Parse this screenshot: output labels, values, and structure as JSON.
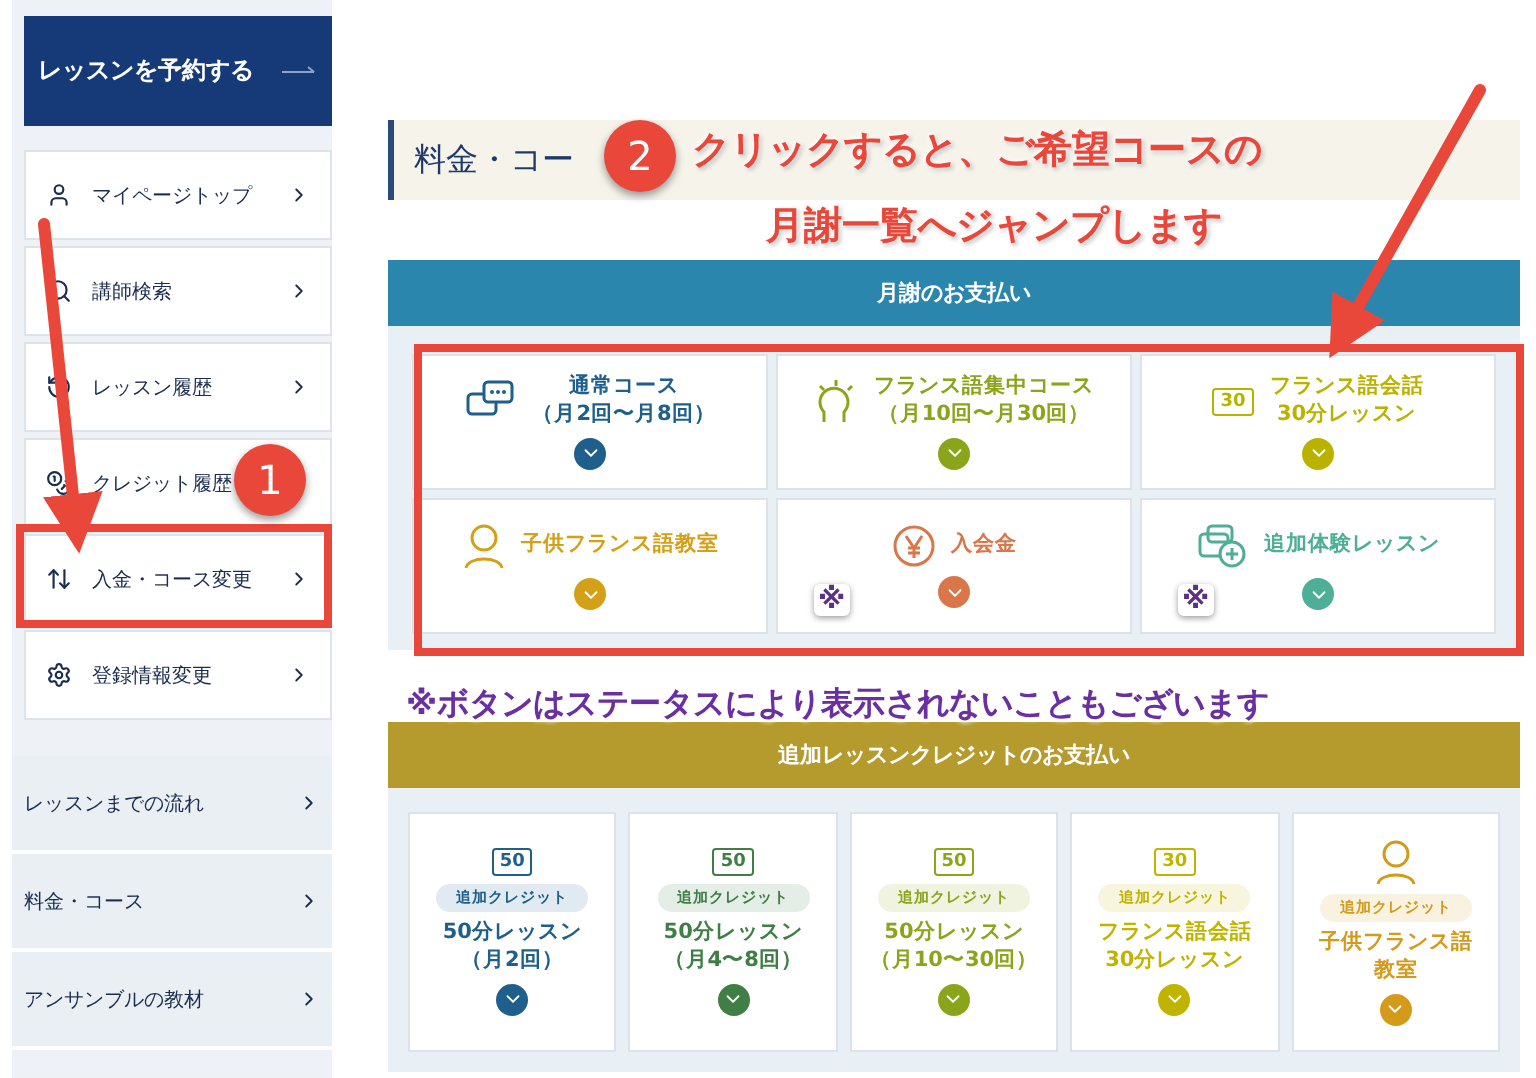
{
  "sidebar": {
    "reserve_button": "レッスンを予約する",
    "menu": [
      {
        "kind": "user",
        "label": "マイページトップ"
      },
      {
        "kind": "search",
        "label": "講師検索"
      },
      {
        "kind": "history",
        "label": "レッスン履歴"
      },
      {
        "kind": "coins",
        "label": "クレジット履歴"
      },
      {
        "kind": "updown",
        "label": "入金・コース変更"
      },
      {
        "kind": "gear",
        "label": "登録情報変更"
      }
    ],
    "links": [
      "レッスンまでの流れ",
      "料金・コース",
      "アンサンブルの教材"
    ]
  },
  "page_title": "料金・コー",
  "monthly": {
    "header": "月謝のお支払い",
    "cards": [
      {
        "kind": "chat",
        "lines": [
          "通常コース",
          "（月2回〜月8回）"
        ],
        "color": "#1f5f8b"
      },
      {
        "kind": "head",
        "lines": [
          "フランス語集中コース",
          "（月10回〜月30回）"
        ],
        "color": "#8aa51a"
      },
      {
        "kind": "number",
        "badge": "30",
        "lines": [
          "フランス語会話",
          "30分レッスン"
        ],
        "color": "#b9b300"
      },
      {
        "kind": "person",
        "lines": [
          "子供フランス語教室"
        ],
        "color": "#d4a017"
      },
      {
        "kind": "yen",
        "lines": [
          "入会金"
        ],
        "color": "#d9764a",
        "mark": "※"
      },
      {
        "kind": "add",
        "lines": [
          "追加体験レッスン"
        ],
        "color": "#4fae96",
        "mark": "※"
      }
    ]
  },
  "credits": {
    "header": "追加レッスンクレジットのお支払い",
    "cards": [
      {
        "kind": "number",
        "badge": "50",
        "tag": "追加クレジット",
        "lines": [
          "50分レッスン",
          "（月2回）"
        ],
        "color": "#1f5f8b"
      },
      {
        "kind": "number",
        "badge": "50",
        "tag": "追加クレジット",
        "lines": [
          "50分レッスン",
          "（月4〜8回）"
        ],
        "color": "#3f7f45"
      },
      {
        "kind": "number",
        "badge": "50",
        "tag": "追加クレジット",
        "lines": [
          "50分レッスン",
          "（月10〜30回）"
        ],
        "color": "#8aa51a"
      },
      {
        "kind": "number",
        "badge": "30",
        "tag": "追加クレジット",
        "lines": [
          "フランス語会話",
          "30分レッスン"
        ],
        "color": "#c0b400"
      },
      {
        "kind": "person",
        "tag": "追加クレジット",
        "lines": [
          "子供フランス語",
          "教室"
        ],
        "color": "#d49a1a"
      }
    ]
  },
  "annotations": {
    "steps": [
      "1",
      "2"
    ],
    "callout": [
      "クリックすると、ご希望コースの",
      "月謝一覧へジャンプします"
    ],
    "note": "※ボタンはステータスにより表示されないこともございます"
  }
}
